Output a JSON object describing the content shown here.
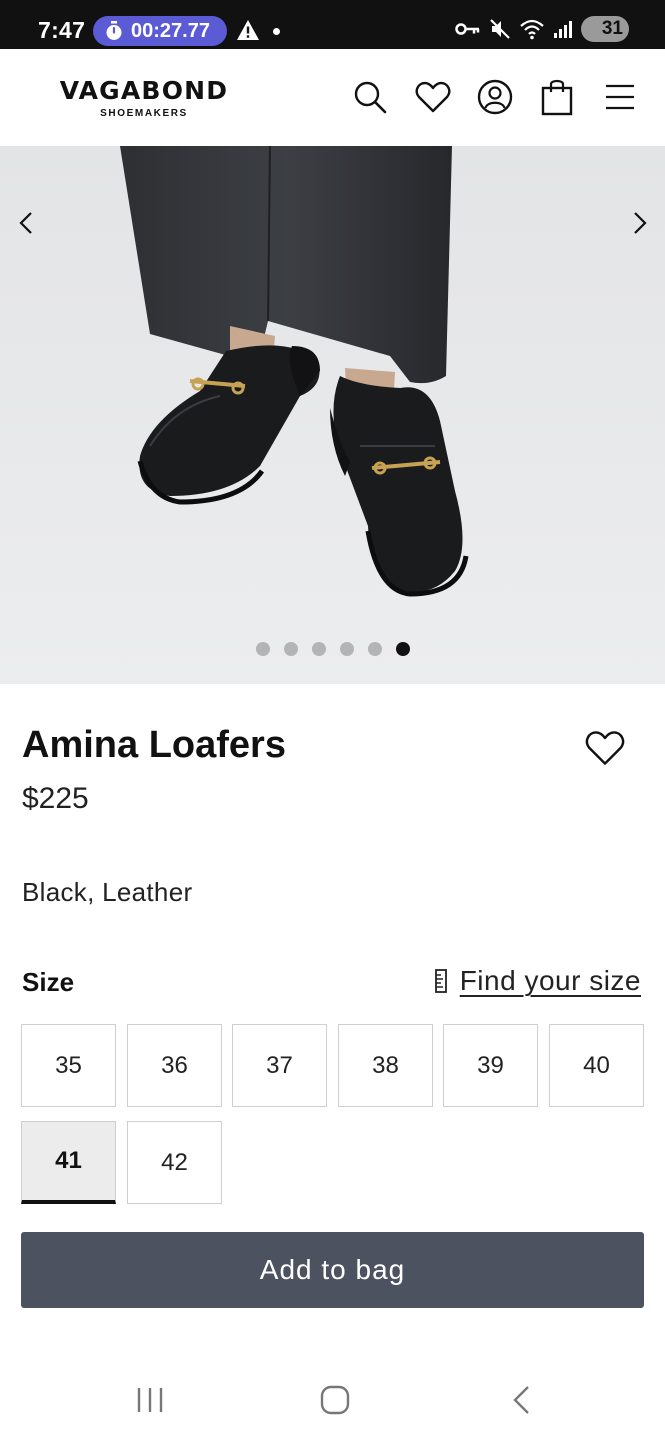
{
  "status_bar": {
    "time": "7:47",
    "timer": "00:27.77",
    "battery": "31"
  },
  "header": {
    "brand": "VAGABOND",
    "brand_sub": "SHOEMAKERS",
    "icons": [
      "search-icon",
      "heart-icon",
      "account-icon",
      "bag-icon",
      "menu-icon"
    ]
  },
  "gallery": {
    "image_count": 6,
    "active_index": 5
  },
  "product": {
    "title": "Amina Loafers",
    "price": "$225",
    "color": "Black, Leather"
  },
  "size_section": {
    "label": "Size",
    "find_size": "Find your size",
    "sizes": [
      "35",
      "36",
      "37",
      "38",
      "39",
      "40",
      "41",
      "42"
    ],
    "selected": "41"
  },
  "cta": {
    "add_to_bag": "Add to bag"
  },
  "colors": {
    "status_bar": "#111111",
    "timer_pill": "#5b5bd6",
    "cta_background": "#4d5261",
    "selected_size_background": "#ececec"
  }
}
